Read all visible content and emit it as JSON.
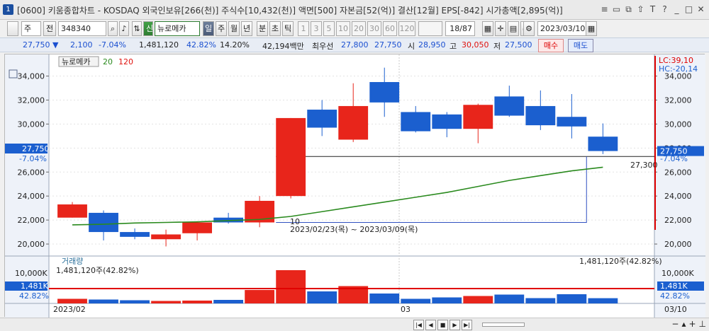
{
  "title": {
    "winnum": "1",
    "text": "[0600] 키움종합차트 - KOSDAQ 외국인보유[266(천)] 주식수[10,432(천)] 액면[500] 자본금[52(억)] 결산[12월] EPS[-842] 시가총액[2,895(억)]",
    "controls": [
      "≡",
      "▭",
      "⧉",
      "⇧",
      "T",
      "?",
      "_",
      "□",
      "✕"
    ]
  },
  "toolbar": {
    "market": "주",
    "prev_label": "전",
    "code": "348340",
    "shin": "신",
    "stock_name": "뉴로메카",
    "periods": [
      "일",
      "주",
      "월",
      "년",
      "분",
      "초",
      "틱"
    ],
    "intervals": [
      "1",
      "3",
      "5",
      "10",
      "20",
      "30",
      "60",
      "120"
    ],
    "page_ratio": "18/87",
    "date": "2023/03/10"
  },
  "info": {
    "price": "27,750 ▼",
    "change": "2,100",
    "rate": "-7.04%",
    "volume": "1,481,120",
    "vol_ratio": "42.82%",
    "turnover": "14.20%",
    "amount": "42,194백만",
    "best_label": "최우선",
    "ask": "27,800",
    "bid": "27,750",
    "open_label": "시",
    "open": "28,950",
    "high_label": "고",
    "high": "30,050",
    "low_label": "저",
    "low": "27,500",
    "buy": "매수",
    "sell": "매도"
  },
  "legend": {
    "name": "뉴로메카",
    "ma1": "20",
    "ma2": "120"
  },
  "annotations": {
    "lc": "LC:39,10",
    "hc": "HC:-20,14",
    "price_tag": "27,750",
    "pct_tag": "-7.04%",
    "line_price": "27,300",
    "range_count": "10",
    "range_text": "2023/02/23(목) ~ 2023/03/09(목)"
  },
  "volume_panel": {
    "title": "거래량",
    "value_left": "1,481,120주(42.82%)",
    "value_right": "1,481,120주(42.82%)",
    "tag": "1,481K",
    "tag_pct": "42.82%",
    "axis_label": "10,000K"
  },
  "x_axis": {
    "left": "2023/02",
    "mid": "03",
    "right": "03/10"
  },
  "chart_data": {
    "type": "candlestick",
    "y_ticks": [
      20000,
      22000,
      24000,
      26000,
      28000,
      30000,
      32000,
      34000
    ],
    "ylim": [
      19000,
      35800
    ],
    "candles": [
      {
        "o": 22200,
        "c": 23300,
        "h": 23500,
        "l": 22200
      },
      {
        "o": 22600,
        "c": 21000,
        "h": 22800,
        "l": 20300
      },
      {
        "o": 21000,
        "c": 20600,
        "h": 21300,
        "l": 20400
      },
      {
        "o": 20400,
        "c": 20800,
        "h": 21200,
        "l": 19800
      },
      {
        "o": 20900,
        "c": 21800,
        "h": 21900,
        "l": 20300
      },
      {
        "o": 22200,
        "c": 21800,
        "h": 22600,
        "l": 21700
      },
      {
        "o": 21800,
        "c": 23600,
        "h": 24000,
        "l": 21400
      },
      {
        "o": 24000,
        "c": 30500,
        "h": 30500,
        "l": 23800
      },
      {
        "o": 31200,
        "c": 29700,
        "h": 32000,
        "l": 29000
      },
      {
        "o": 28700,
        "c": 31500,
        "h": 33400,
        "l": 28500
      },
      {
        "o": 33500,
        "c": 31800,
        "h": 34700,
        "l": 30600
      },
      {
        "o": 31000,
        "c": 29400,
        "h": 31500,
        "l": 29300
      },
      {
        "o": 30800,
        "c": 29600,
        "h": 31000,
        "l": 28900
      },
      {
        "o": 29600,
        "c": 31600,
        "h": 31700,
        "l": 28400
      },
      {
        "o": 32300,
        "c": 30700,
        "h": 33200,
        "l": 30600
      },
      {
        "o": 31500,
        "c": 29900,
        "h": 32800,
        "l": 29500
      },
      {
        "o": 30600,
        "c": 29800,
        "h": 32500,
        "l": 28800
      },
      {
        "o": 28950,
        "c": 27750,
        "h": 30050,
        "l": 27500
      }
    ],
    "ma20": [
      21600,
      21650,
      21750,
      21800,
      21850,
      21950,
      22050,
      22300,
      22700,
      23100,
      23500,
      23900,
      24300,
      24800,
      25300,
      25700,
      26100,
      26400
    ],
    "volumes": [
      1300,
      1100,
      900,
      700,
      800,
      1000,
      3800,
      9400,
      3400,
      4900,
      2800,
      1300,
      1700,
      2100,
      2500,
      1500,
      2600,
      1481
    ],
    "volume_ymax": 12000,
    "volume_ref": 4200,
    "colors": {
      "up": "#e8251b",
      "down": "#1b5fcf",
      "ma": "#2a8a1e",
      "ref": "#e00000",
      "hline": "#222",
      "range": "#3050c0"
    }
  }
}
